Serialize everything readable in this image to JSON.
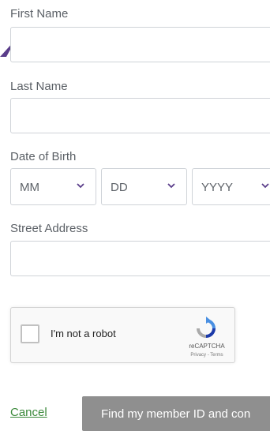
{
  "form": {
    "first_name_label": "First Name",
    "first_name_value": "",
    "last_name_label": "Last Name",
    "last_name_value": "",
    "dob_label": "Date of Birth",
    "dob_month": "MM",
    "dob_day": "DD",
    "dob_year": "YYYY",
    "street_label": "Street Address",
    "street_value": ""
  },
  "captcha": {
    "checkbox_label": "I'm not a robot",
    "brand": "reCAPTCHA",
    "links": "Privacy - Terms"
  },
  "actions": {
    "cancel_label": "Cancel",
    "submit_label": "Find my member ID and con"
  },
  "colors": {
    "accent": "#5a3d8a",
    "link": "#3c8a3c",
    "button_bg": "#8f8f8f",
    "border": "#cfd3d8"
  }
}
